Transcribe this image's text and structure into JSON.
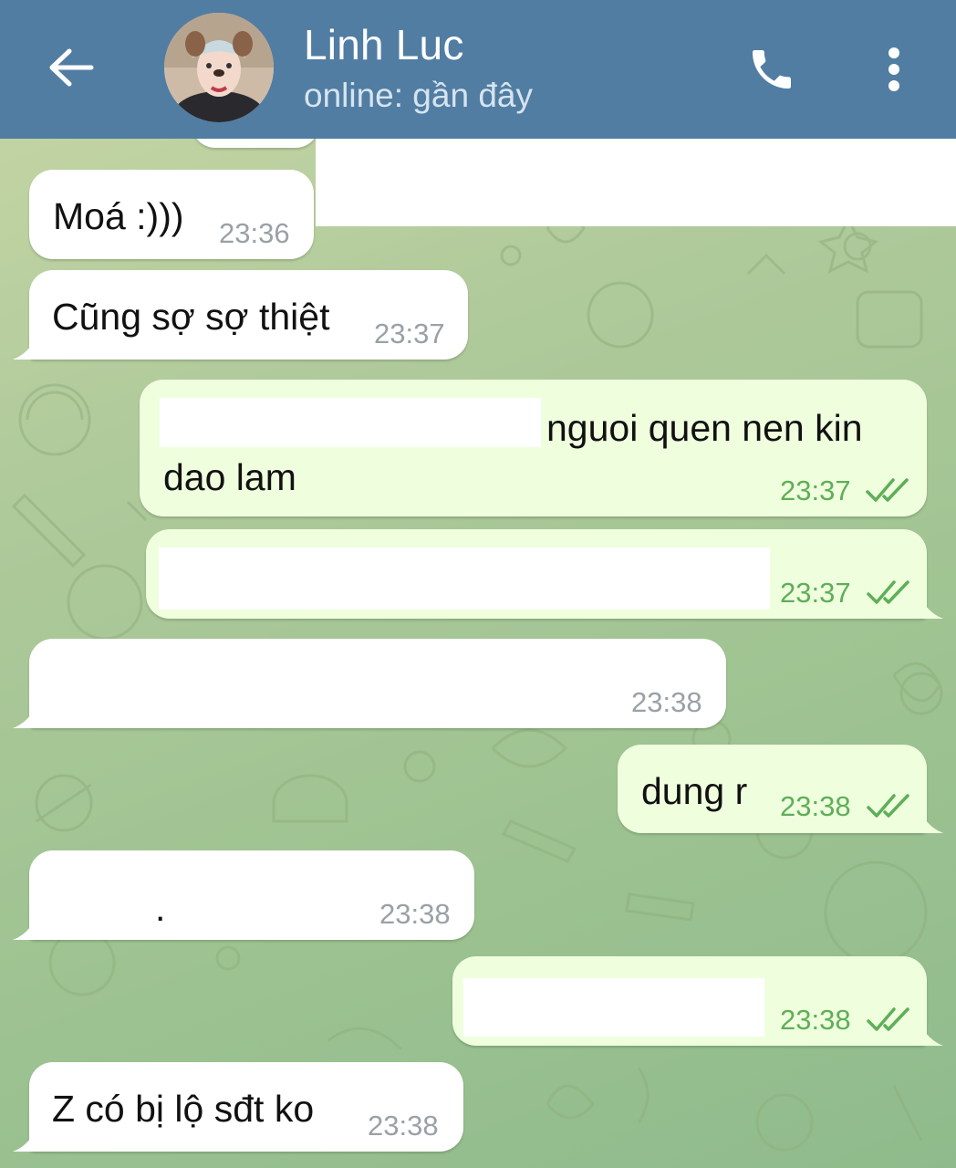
{
  "header": {
    "contact_name": "Linh Luc",
    "status": "online: gần đây",
    "back_icon": "arrow-left-icon",
    "call_icon": "phone-icon",
    "menu_icon": "more-vertical-icon",
    "bar_color": "#517da2"
  },
  "messages": [
    {
      "direction": "incoming",
      "text": "Moá :)))",
      "time": "23:36"
    },
    {
      "direction": "incoming",
      "text": "Cũng sợ sợ thiệt",
      "time": "23:37"
    },
    {
      "direction": "outgoing",
      "text_line1": "nguoi quen nen kin",
      "text_line2": "dao lam",
      "time": "23:37",
      "read": true,
      "partially_redacted": true
    },
    {
      "direction": "outgoing",
      "text": "",
      "time": "23:37",
      "read": true,
      "redacted": true
    },
    {
      "direction": "incoming",
      "text": "",
      "time": "23:38",
      "redacted": true
    },
    {
      "direction": "outgoing",
      "text": "dung r",
      "time": "23:38",
      "read": true
    },
    {
      "direction": "incoming",
      "text": ".",
      "time": "23:38"
    },
    {
      "direction": "outgoing",
      "text": "",
      "time": "23:38",
      "read": true,
      "redacted": true
    },
    {
      "direction": "incoming",
      "text": "Z có bị lộ sđt ko",
      "time": "23:38"
    }
  ],
  "colors": {
    "incoming_bubble": "#ffffff",
    "outgoing_bubble": "#efffde",
    "outgoing_time": "#5fae58",
    "incoming_time": "#9aa1a6"
  }
}
